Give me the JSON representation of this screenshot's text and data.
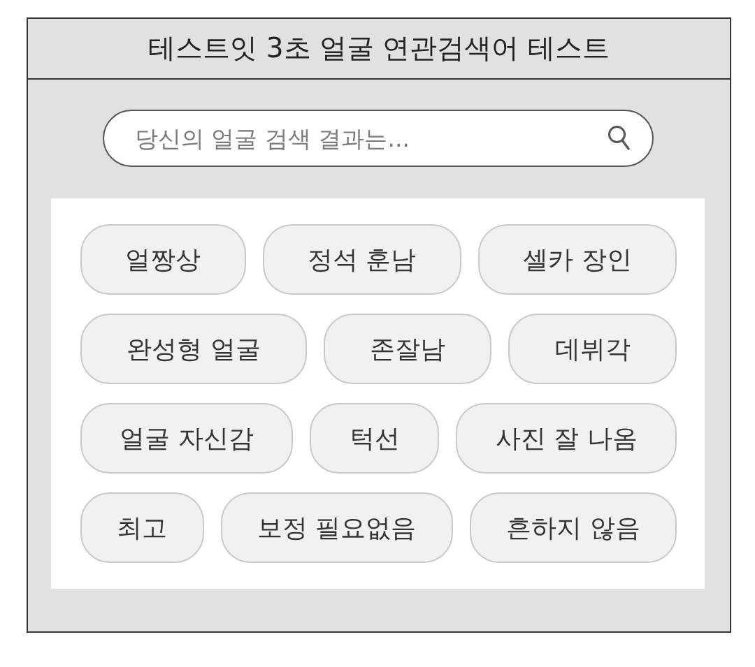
{
  "window": {
    "title": "테스트잇 3초 얼굴 연관검색어 테스트"
  },
  "search": {
    "placeholder": "당신의 얼굴 검색 결과는..."
  },
  "tags": {
    "rows": [
      [
        {
          "label": "얼짱상"
        },
        {
          "label": "정석 훈남"
        },
        {
          "label": "셀카 장인"
        }
      ],
      [
        {
          "label": "완성형 얼굴"
        },
        {
          "label": "존잘남"
        },
        {
          "label": "데뷔각"
        }
      ],
      [
        {
          "label": "얼굴 자신감"
        },
        {
          "label": "턱선"
        },
        {
          "label": "사진 잘 나옴"
        }
      ],
      [
        {
          "label": "최고"
        },
        {
          "label": "보정 필요없음"
        },
        {
          "label": "흔하지 않음"
        }
      ]
    ]
  }
}
